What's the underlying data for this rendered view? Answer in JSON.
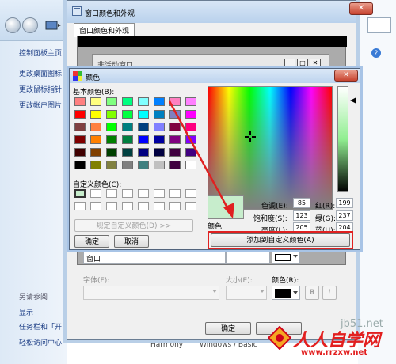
{
  "control_panel": {
    "sidebar_links": [
      "控制面板主页",
      "更改桌面图标",
      "更改鼠标指针",
      "更改帐户图片"
    ],
    "see_also": "另请参阅",
    "see_also_links": [
      "显示",
      "任务栏和「开",
      "轻松访问中心"
    ],
    "theme_names": [
      "Harmony",
      "Windows / Basic"
    ]
  },
  "appearance_dialog": {
    "title": "窗口颜色和外观",
    "tab": "窗口颜色和外观",
    "inactive_window_title": "非活动窗口",
    "item_value": "窗口",
    "font_label": "字体(F):",
    "size_label": "大小(E):",
    "color_label": "颜色(R):",
    "bold_label": "B",
    "italic_label": "I",
    "ok_label": "确定"
  },
  "color_dialog": {
    "title": "颜色",
    "basic_colors_label": "基本颜色(B):",
    "custom_colors_label": "自定义颜色(C):",
    "define_custom_label": "规定自定义颜色(D) >>",
    "ok_label": "确定",
    "cancel_label": "取消",
    "add_custom_label": "添加到自定义颜色(A)",
    "color_solid_label": "颜色",
    "hue_label": "色调(E):",
    "hue": "85",
    "sat_label": "饱和度(S):",
    "sat": "123",
    "lum_label": "亮度(L):",
    "lum": "205",
    "red_label": "红(R):",
    "red": "199",
    "green_label": "绿(G):",
    "green": "237",
    "blue_label": "蓝(U):",
    "blue": "204",
    "selected_color": "#c7edcc",
    "basic_colors": [
      [
        "#ff8080",
        "#ffff80",
        "#80ff80",
        "#00ff80",
        "#80ffff",
        "#0080ff",
        "#ff80c0",
        "#ff80ff"
      ],
      [
        "#ff0000",
        "#ffff00",
        "#80ff00",
        "#00ff40",
        "#00ffff",
        "#0080c0",
        "#8080c0",
        "#ff00ff"
      ],
      [
        "#804040",
        "#ff8040",
        "#00ff00",
        "#008080",
        "#004080",
        "#8080ff",
        "#800040",
        "#ff0080"
      ],
      [
        "#800000",
        "#ff8000",
        "#008000",
        "#008040",
        "#0000ff",
        "#0000a0",
        "#800080",
        "#8000ff"
      ],
      [
        "#400000",
        "#804000",
        "#004000",
        "#004040",
        "#000080",
        "#000040",
        "#400040",
        "#400080"
      ],
      [
        "#000000",
        "#808000",
        "#808040",
        "#808080",
        "#408080",
        "#c0c0c0",
        "#400040",
        "#ffffff"
      ]
    ]
  },
  "watermark": {
    "site": "jb51.net",
    "brand": "人人自学网",
    "url": "www.rrzxw.net"
  },
  "colors": {
    "annotation_red": "#e02020"
  }
}
